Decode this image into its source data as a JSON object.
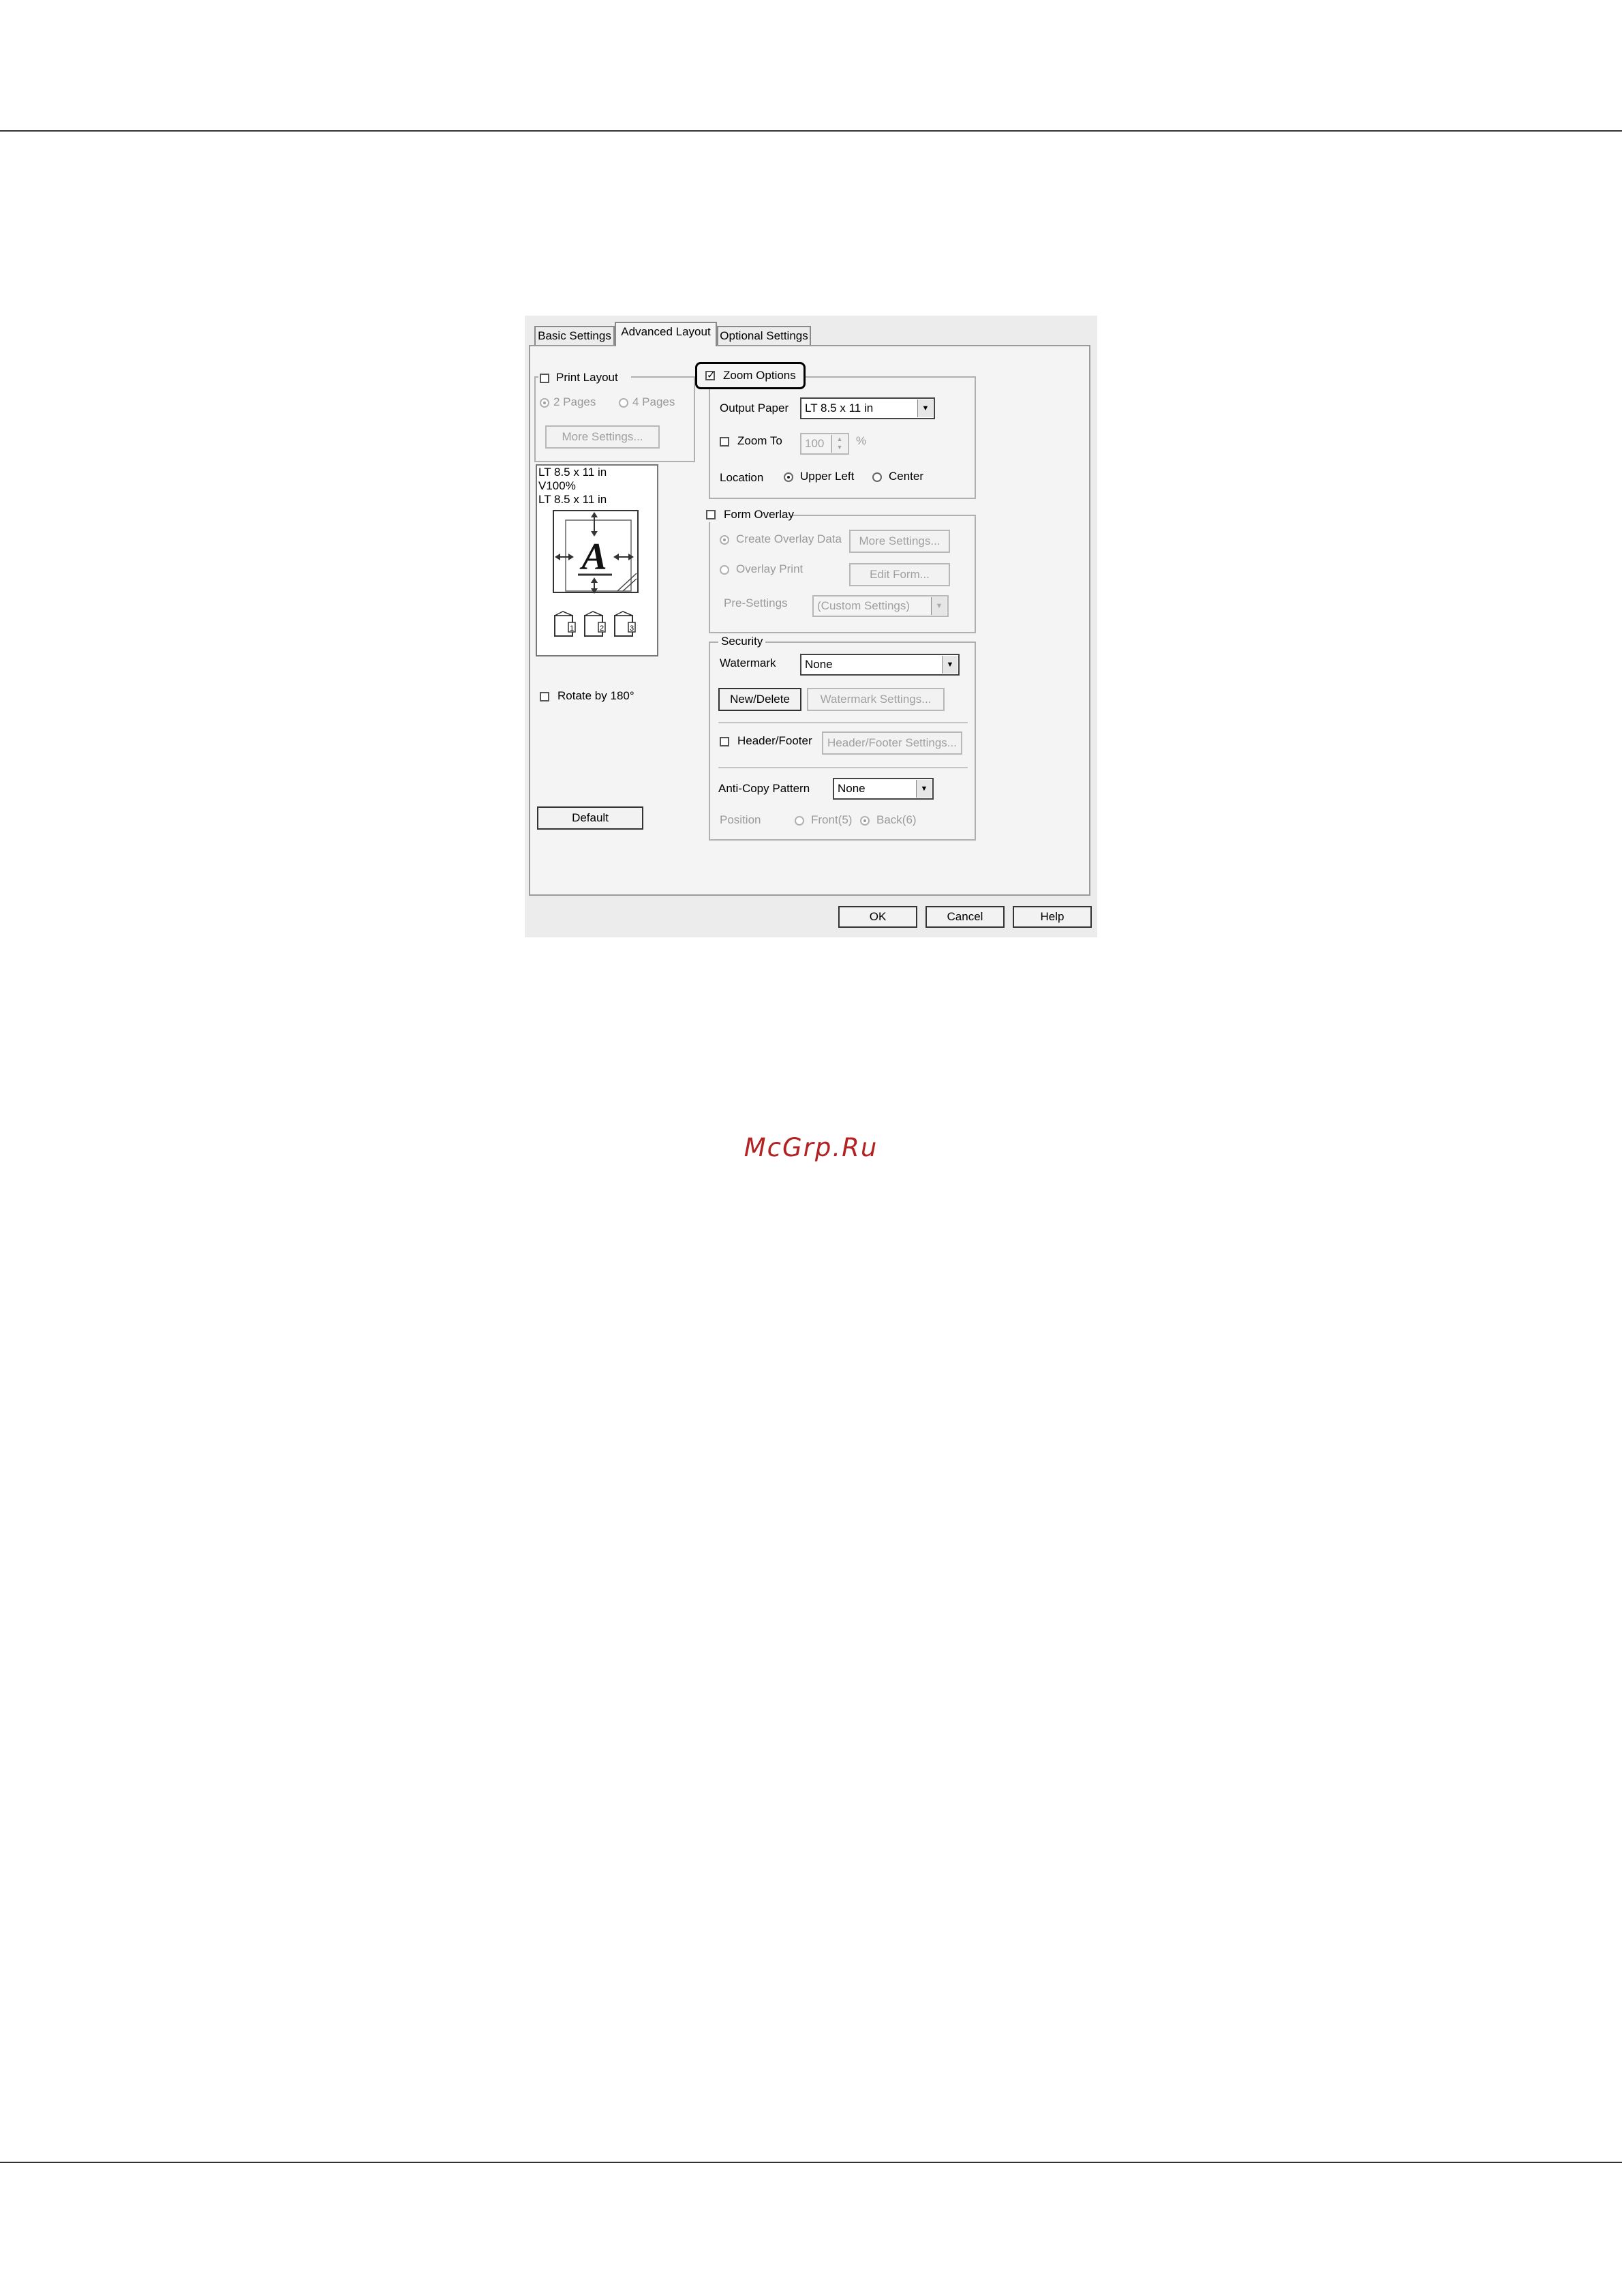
{
  "dialog": {
    "tabs": [
      "Basic Settings",
      "Advanced Layout",
      "Optional Settings"
    ],
    "print_layout": {
      "label": "Print Layout",
      "checked": false,
      "options": [
        "2 Pages",
        "4 Pages"
      ],
      "more_settings": "More Settings..."
    },
    "preview_lines": [
      "LT 8.5 x 11 in",
      "V100%",
      "LT 8.5 x 11 in"
    ],
    "preview_letter": "A",
    "preview_pages": [
      "1",
      "2",
      "3"
    ],
    "rotate": {
      "label": "Rotate by 180°",
      "checked": false
    },
    "default_button": "Default",
    "zoom_options": {
      "label": "Zoom Options",
      "checked": true,
      "output_paper_label": "Output Paper",
      "output_paper_value": "LT 8.5 x 11 in",
      "zoom_to_label": "Zoom To",
      "zoom_to_value": "100",
      "zoom_unit": "%",
      "location_label": "Location",
      "location_options": [
        "Upper Left",
        "Center"
      ]
    },
    "form_overlay": {
      "label": "Form Overlay",
      "checked": false,
      "create_label": "Create Overlay Data",
      "more_settings": "More Settings...",
      "overlay_print": "Overlay Print",
      "edit_form": "Edit Form...",
      "presettings_label": "Pre-Settings",
      "presettings_value": "(Custom Settings)"
    },
    "security": {
      "label": "Security",
      "watermark_label": "Watermark",
      "watermark_value": "None",
      "new_delete": "New/Delete",
      "watermark_settings": "Watermark Settings...",
      "header_footer_label": "Header/Footer",
      "header_footer_checked": false,
      "header_footer_settings": "Header/Footer Settings...",
      "anticopy_label": "Anti-Copy Pattern",
      "anticopy_value": "None",
      "position_label": "Position",
      "position_options": [
        "Front(5)",
        "Back(6)"
      ]
    },
    "buttons": {
      "ok": "OK",
      "cancel": "Cancel",
      "help": "Help"
    }
  },
  "watermark_text": "McGrp.Ru"
}
